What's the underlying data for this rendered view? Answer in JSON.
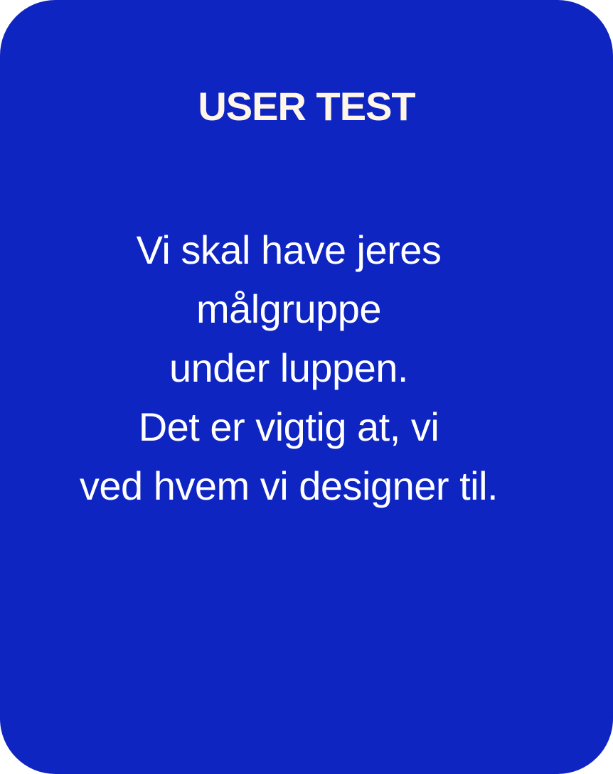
{
  "card": {
    "title": "USER TEST",
    "body_lines": [
      "Vi skal have jeres",
      "målgruppe",
      "under luppen.",
      "Det er vigtig at, vi",
      "ved hvem vi designer til."
    ]
  },
  "colors": {
    "card_background": "#0e25c2",
    "title_text": "#fff6e8",
    "body_text": "#ffffff"
  }
}
